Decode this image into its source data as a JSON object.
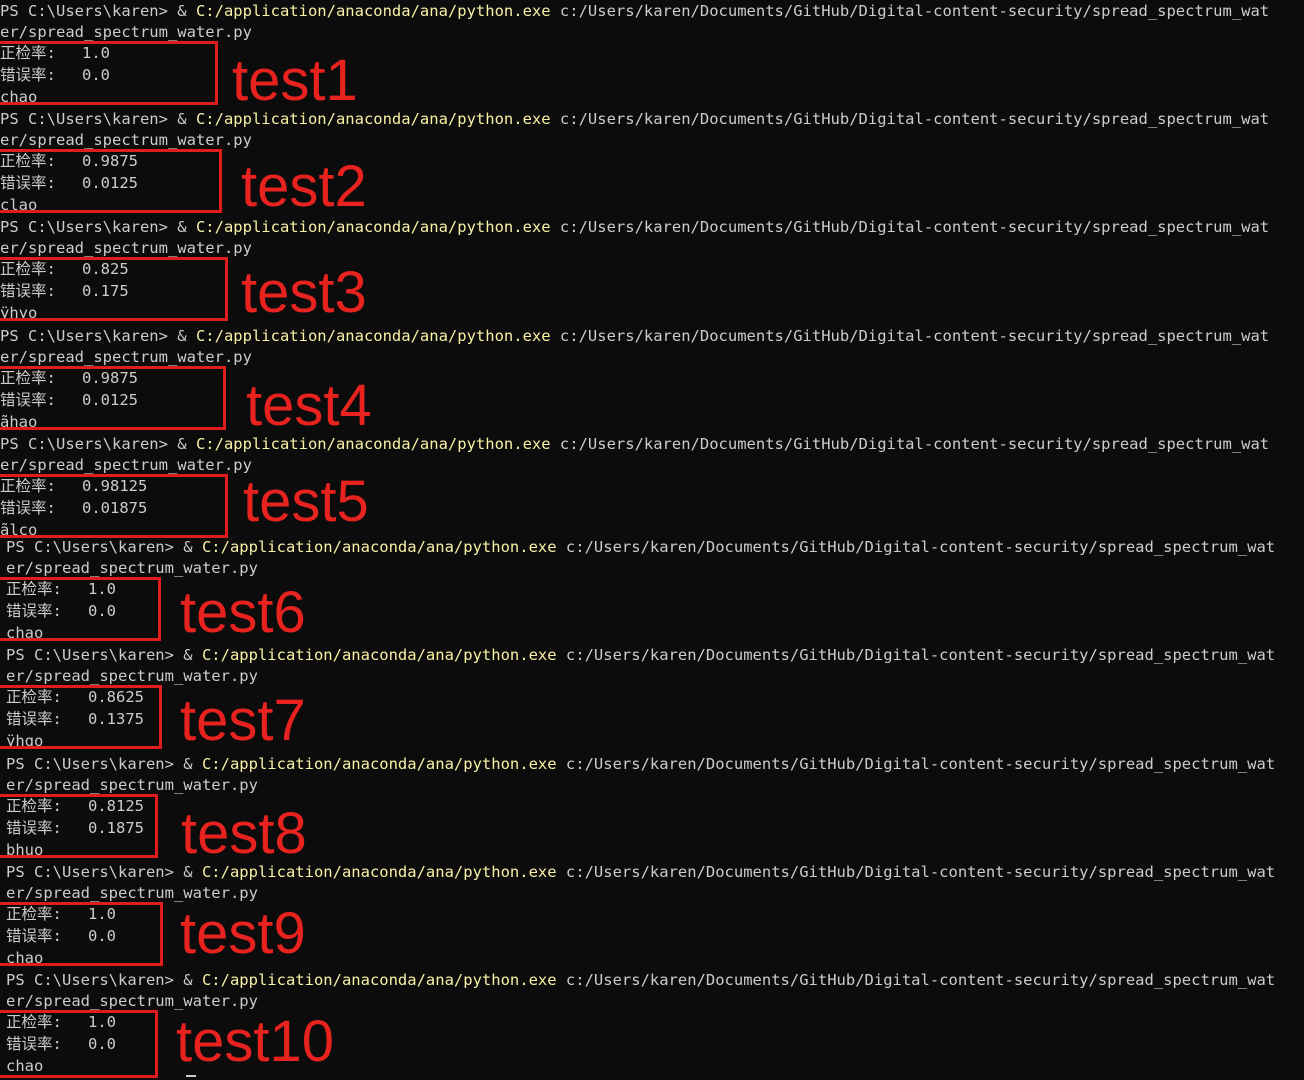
{
  "terminal": {
    "prompt": "PS C:\\Users\\karen> & ",
    "exe_path": "C:/application/anaconda/ana/python.exe",
    "script_path": " c:/Users/karen/Documents/GitHub/Digital-content-security/spread_spectrum_wat",
    "script_path_cont": "er/spread_spectrum_water.py",
    "detection_label": "正检率:",
    "error_label": "错误率:"
  },
  "runs": [
    {
      "tag": "test1",
      "detection_rate": "1.0",
      "error_rate": "0.0",
      "decoded": "chao"
    },
    {
      "tag": "test2",
      "detection_rate": "0.9875",
      "error_rate": "0.0125",
      "decoded": "clao"
    },
    {
      "tag": "test3",
      "detection_rate": "0.825",
      "error_rate": "0.175",
      "decoded": "ÿhyo"
    },
    {
      "tag": "test4",
      "detection_rate": "0.9875",
      "error_rate": "0.0125",
      "decoded": "ãhao"
    },
    {
      "tag": "test5",
      "detection_rate": "0.98125",
      "error_rate": "0.01875",
      "decoded": "ãlco"
    },
    {
      "tag": "test6",
      "detection_rate": "1.0",
      "error_rate": "0.0",
      "decoded": "chao"
    },
    {
      "tag": "test7",
      "detection_rate": "0.8625",
      "error_rate": "0.1375",
      "decoded": "ÿhqo"
    },
    {
      "tag": "test8",
      "detection_rate": "0.8125",
      "error_rate": "0.1875",
      "decoded": "þhuo"
    },
    {
      "tag": "test9",
      "detection_rate": "1.0",
      "error_rate": "0.0",
      "decoded": "chao"
    },
    {
      "tag": "test10",
      "detection_rate": "1.0",
      "error_rate": "0.0",
      "decoded": "chao"
    }
  ],
  "colors": {
    "background": "#0c0c0c",
    "text": "#cccccc",
    "exe_highlight": "#f9f1a5",
    "annotation_red": "#e8231f"
  }
}
